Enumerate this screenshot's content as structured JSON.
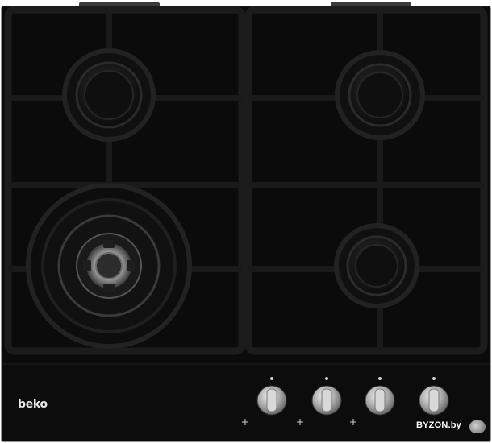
{
  "product": {
    "brand_logo": "beko",
    "burner_count": 4,
    "knob_count": 4
  },
  "watermark": {
    "text": "BYZON.by"
  },
  "colors": {
    "glass": "#0b0b0b",
    "grate": "#161616",
    "knob_metal": "#b8b8b8",
    "background": "#ffffff"
  }
}
